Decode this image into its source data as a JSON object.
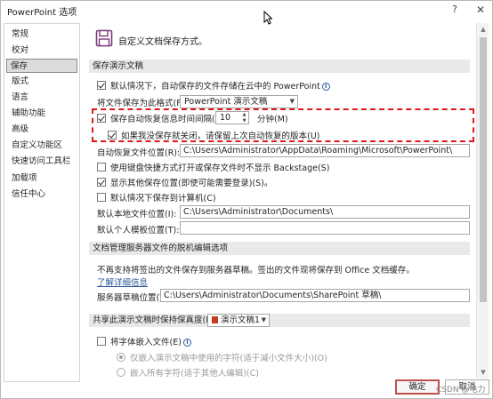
{
  "window": {
    "title": "PowerPoint 选项",
    "help_label": "?",
    "close_label": "✕"
  },
  "sidebar": {
    "items": [
      {
        "label": "常规"
      },
      {
        "label": "校对"
      },
      {
        "label": "保存",
        "selected": true
      },
      {
        "label": "版式"
      },
      {
        "label": "语言"
      },
      {
        "label": "辅助功能"
      },
      {
        "label": "高级"
      },
      {
        "label": "自定义功能区"
      },
      {
        "label": "快速访问工具栏"
      },
      {
        "label": "加载项"
      },
      {
        "label": "信任中心"
      }
    ]
  },
  "header": {
    "icon": "save-disk-icon",
    "text": "自定义文档保存方式。"
  },
  "save_presentations": {
    "section_title": "保存演示文稿",
    "default_cloud_label": "默认情况下，自动保存的文件存储在云中的 PowerPoint",
    "default_cloud_checked": true,
    "format_label": "将文件保存为此格式(F):",
    "format_value": "PowerPoint 演示文稿",
    "autorecover_label": "保存自动恢复信息时间间隔(A)",
    "autorecover_checked": true,
    "autorecover_minutes": "10",
    "minutes_label": "分钟(M)",
    "keep_last_label": "如果我没保存就关闭，请保留上次自动恢复的版本(U)",
    "keep_last_checked": true,
    "autorecover_location_label": "自动恢复文件位置(R):",
    "autorecover_location_value": "C:\\Users\\Administrator\\AppData\\Roaming\\Microsoft\\PowerPoint\\",
    "no_backstage_label": "使用键盘快捷方式打开或保存文件时不显示 Backstage(S)",
    "no_backstage_checked": false,
    "show_additional_label": "显示其他保存位置(即使可能需要登录)(S)。",
    "show_additional_checked": true,
    "save_to_computer_label": "默认情况下保存到计算机(C)",
    "save_to_computer_checked": false,
    "local_location_label": "默认本地文件位置(I):",
    "local_location_value": "C:\\Users\\Administrator\\Documents\\",
    "template_location_label": "默认个人模板位置(T):",
    "template_location_value": ""
  },
  "offline_editing": {
    "section_title": "文档管理服务器文件的脱机编辑选项",
    "description": "不再支持将签出的文件保存到服务器草稿。签出的文件现将保存到 Office 文档缓存。",
    "learn_more": "了解详细信息",
    "drafts_label": "服务器草稿位置(V):",
    "drafts_value": "C:\\Users\\Administrator\\Documents\\SharePoint 草稿\\"
  },
  "fidelity": {
    "section_title": "共享此演示文稿时保持保真度(D):",
    "document_value": "演示文稿1",
    "embed_fonts_label": "将字体嵌入文件(E)",
    "embed_fonts_checked": false,
    "embed_used_label": "仅嵌入演示文稿中使用的字符(适于减小文件大小)(O)",
    "embed_all_label": "嵌入所有字符(适于其他人编辑)(C)"
  },
  "footer": {
    "ok_label": "确定",
    "cancel_label": "取消"
  },
  "watermark": "CSDN @电力"
}
